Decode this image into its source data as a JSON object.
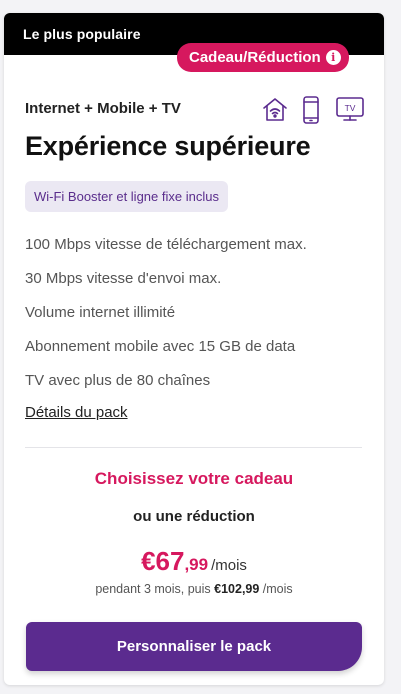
{
  "header": {
    "label": "Le plus populaire",
    "badge": "Cadeau/Réduction",
    "badge_icon": "info-icon"
  },
  "pack": {
    "subtitle": "Internet + Mobile + TV",
    "icons": [
      "wifi-home-icon",
      "mobile-phone-icon",
      "tv-icon"
    ],
    "tv_icon_text": "TV",
    "title": "Expérience supérieure",
    "chip": "Wi-Fi Booster et ligne fixe inclus",
    "features": [
      "100 Mbps vitesse de téléchargement max.",
      "30 Mbps vitesse d'envoi max.",
      "Volume internet illimité",
      "Abonnement mobile avec 15 GB de data",
      "TV avec plus de 80 chaînes"
    ],
    "details_link": "Détails du pack"
  },
  "offer": {
    "gift_title": "Choisissez votre cadeau",
    "or_reduction": "ou une réduction",
    "price_main": "€67",
    "price_cents": ",99",
    "price_per": "/mois",
    "note_prefix": "pendant 3 mois, puis ",
    "note_price": "€102,99",
    "note_suffix": " /mois"
  },
  "cta": {
    "label": "Personnaliser le pack"
  },
  "colors": {
    "accent": "#d6185e",
    "brand_purple": "#5b2b8f",
    "chip_bg": "#ebe8f3"
  }
}
